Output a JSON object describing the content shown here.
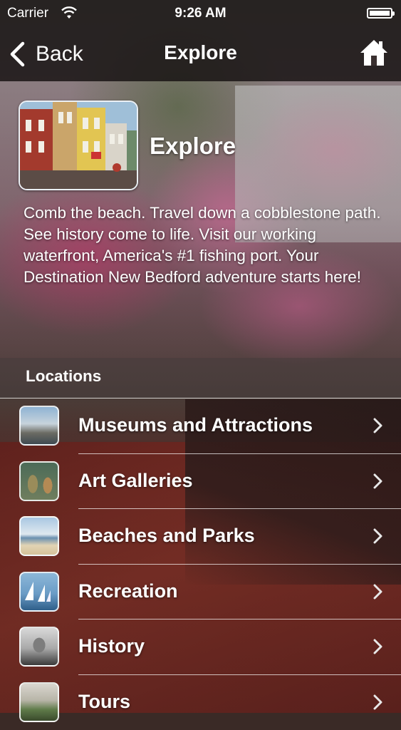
{
  "status_bar": {
    "carrier": "Carrier",
    "time": "9:26 AM"
  },
  "nav": {
    "back_label": "Back",
    "title": "Explore",
    "home_icon": "home-icon"
  },
  "header": {
    "title": "Explore",
    "description": "Comb the beach. Travel down a cobblestone path. See history come to life. Visit our working waterfront, America's #1 fishing port. Your Destination New Bedford adventure starts here!"
  },
  "section": {
    "label": "Locations"
  },
  "locations": [
    {
      "label": "Museums and Attractions"
    },
    {
      "label": "Art Galleries"
    },
    {
      "label": "Beaches and Parks"
    },
    {
      "label": "Recreation"
    },
    {
      "label": "History"
    },
    {
      "label": "Tours"
    }
  ]
}
